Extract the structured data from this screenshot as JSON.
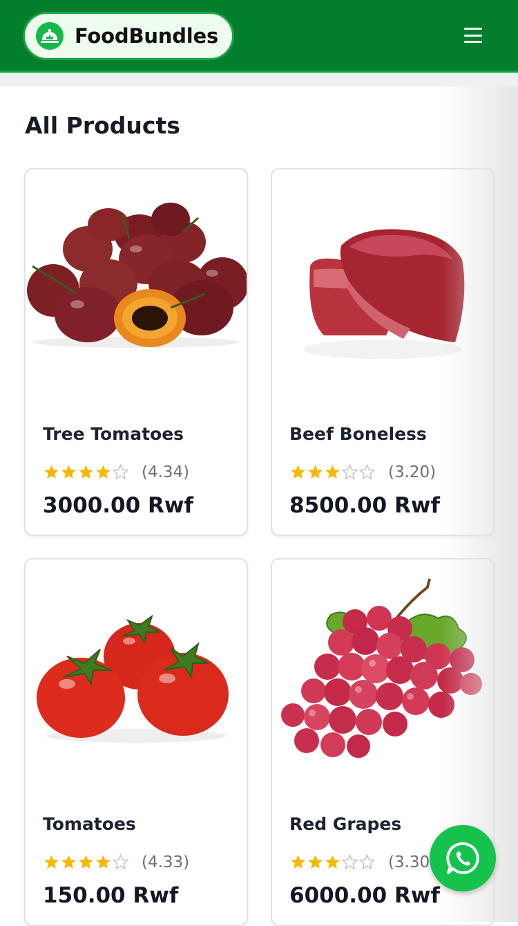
{
  "header": {
    "brand_name": "FoodBundles",
    "logo_icon": "food-cloche-icon",
    "menu_icon": "hamburger-menu-icon",
    "bg_color": "#037e2d"
  },
  "main": {
    "title": "All Products",
    "products": [
      {
        "name": "Tree Tomatoes",
        "rating": 4.34,
        "rating_text": "(4.34)",
        "price": "3000.00 Rwf",
        "image": "tree-tomatoes-image"
      },
      {
        "name": "Beef Boneless",
        "rating": 3.2,
        "rating_text": "(3.20)",
        "price": "8500.00 Rwf",
        "image": "beef-boneless-image"
      },
      {
        "name": "Tomatoes",
        "rating": 4.33,
        "rating_text": "(4.33)",
        "price": "150.00 Rwf",
        "image": "tomatoes-image"
      },
      {
        "name": "Red Grapes",
        "rating": 3.3,
        "rating_text": "(3.30)",
        "price": "6000.00 Rwf",
        "image": "red-grapes-image"
      }
    ]
  },
  "fab": {
    "icon": "whatsapp-icon",
    "color": "#15c24c"
  },
  "colors": {
    "star_filled": "#f6b800",
    "star_empty": "#c4c6c9"
  }
}
